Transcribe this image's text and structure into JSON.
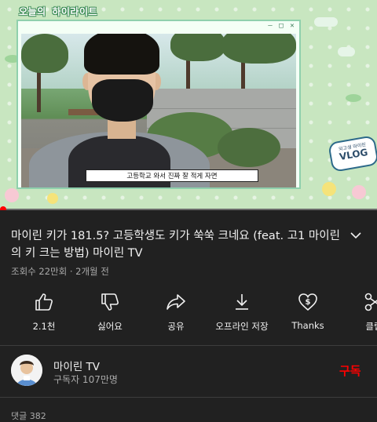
{
  "video": {
    "overlay_title": "오늘의 하이라이트",
    "window_buttons": [
      "—",
      "□",
      "✕"
    ],
    "subtitle": "고등학교 와서 진짜 잘 적게 자면",
    "vlog_badge": {
      "small": "외고생 마이린",
      "big": "VLOG"
    },
    "progress": 0.0
  },
  "title": "마이린 키가 181.5? 고등학생도 키가 쑥쑥 크네요 (feat. 고1 마이린의 키 크는 방법) 마이린 TV",
  "meta": "조회수 22만회 · 2개월 전",
  "actions": [
    {
      "icon": "thumbs-up-icon",
      "label": "2.1천"
    },
    {
      "icon": "thumbs-down-icon",
      "label": "싫어요"
    },
    {
      "icon": "share-icon",
      "label": "공유"
    },
    {
      "icon": "download-icon",
      "label": "오프라인 저장"
    },
    {
      "icon": "thanks-icon",
      "label": "Thanks"
    },
    {
      "icon": "clip-icon",
      "label": "클립"
    }
  ],
  "channel": {
    "name": "마이린 TV",
    "subscribers": "구독자 107만명",
    "subscribe_label": "구독"
  },
  "comments_peek": "댓글 382",
  "colors": {
    "accent": "#ff0000",
    "background": "#212121",
    "muted": "#aaaaaa"
  }
}
